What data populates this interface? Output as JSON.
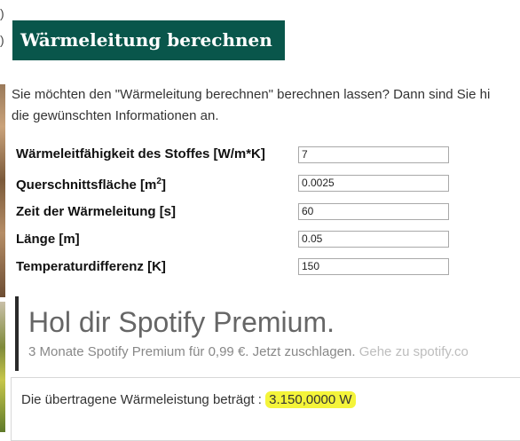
{
  "page": {
    "title": "Wärmeleitung berechnen",
    "intro_line1": "Sie möchten den \"Wärmeleitung berechnen\" berechnen lassen? Dann sind Sie hi",
    "intro_line2": "die gewünschten Informationen an."
  },
  "form": {
    "conductivity": {
      "label": "Wärmeleitfähigkeit des Stoffes [W/m*K]",
      "value": "7"
    },
    "area": {
      "label_main": "Querschnittsfläche [m",
      "label_sup": "2",
      "label_end": "]",
      "value": "0.0025"
    },
    "time": {
      "label": "Zeit der Wärmeleitung [s]",
      "value": "60"
    },
    "length": {
      "label": "Länge [m]",
      "value": "0.05"
    },
    "temp_diff": {
      "label": "Temperaturdifferenz [K]",
      "value": "150"
    }
  },
  "ad": {
    "title": "Hol dir Spotify Premium.",
    "subtitle": "3 Monate Spotify Premium für 0,99 €. Jetzt zuschlagen.",
    "link": "Gehe zu spotify.co"
  },
  "result": {
    "label": "Die übertragene Wärmeleistung beträgt : ",
    "value": "3.150,0000 W"
  },
  "left_strip": {
    "top_marks": [
      ")",
      ")"
    ]
  },
  "colors": {
    "title_bg": "#09564b",
    "highlight": "#f4f43a"
  }
}
